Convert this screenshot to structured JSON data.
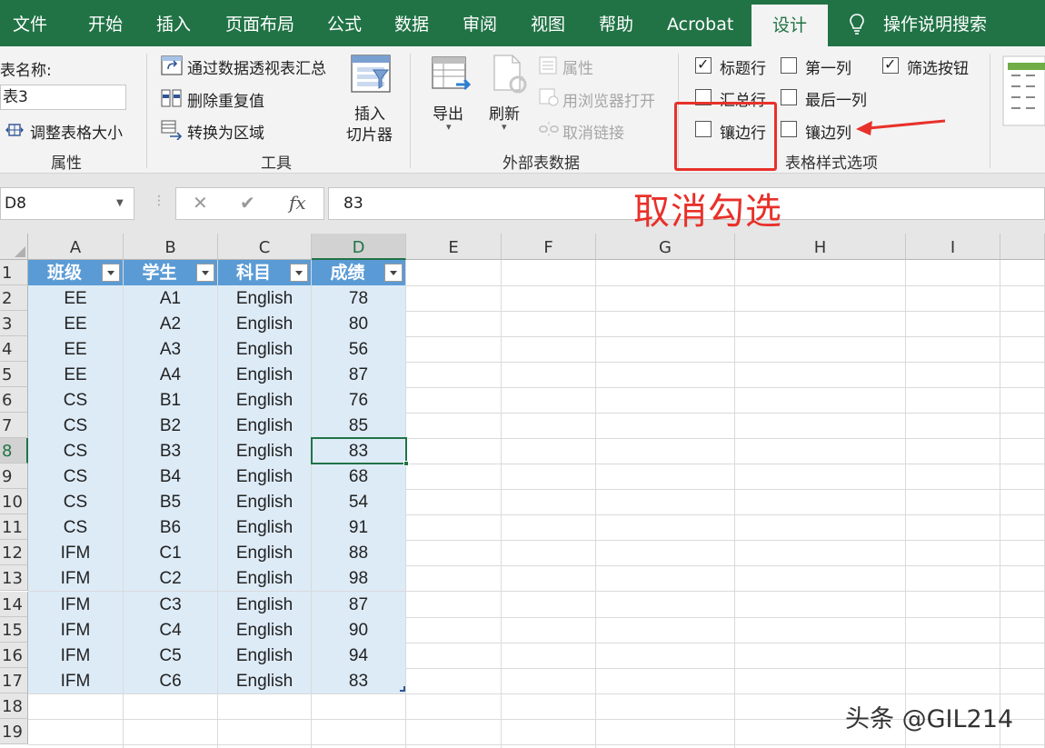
{
  "menu": {
    "tabs": [
      "文件",
      "开始",
      "插入",
      "页面布局",
      "公式",
      "数据",
      "审阅",
      "视图",
      "帮助",
      "Acrobat",
      "设计"
    ],
    "active_tab": "设计",
    "search": "操作说明搜索"
  },
  "ribbon": {
    "properties": {
      "table_name_label": "表名称:",
      "table_name_value": "表3",
      "resize_label": "调整表格大小",
      "group_label": "属性"
    },
    "tools": {
      "pivot_label": "通过数据透视表汇总",
      "dedupe_label": "删除重复值",
      "convert_label": "转换为区域",
      "slicer_label_line1": "插入",
      "slicer_label_line2": "切片器",
      "group_label": "工具"
    },
    "external": {
      "export_label": "导出",
      "refresh_label": "刷新",
      "properties_label": "属性",
      "open_browser_label": "用浏览器打开",
      "unlink_label": "取消链接",
      "group_label": "外部表数据"
    },
    "style_options": {
      "header_row": {
        "label": "标题行",
        "checked": true
      },
      "total_row": {
        "label": "汇总行",
        "checked": false
      },
      "banded_rows": {
        "label": "镶边行",
        "checked": false
      },
      "first_column": {
        "label": "第一列",
        "checked": false
      },
      "last_column": {
        "label": "最后一列",
        "checked": false
      },
      "banded_columns": {
        "label": "镶边列",
        "checked": false
      },
      "filter_button": {
        "label": "筛选按钮",
        "checked": true
      },
      "group_label": "表格样式选项"
    }
  },
  "formula_bar": {
    "name_box": "D8",
    "fx": "fx",
    "value": "83"
  },
  "annotation": "取消勾选",
  "sheet": {
    "columns": [
      "A",
      "B",
      "C",
      "D",
      "E",
      "F",
      "G",
      "H",
      "I"
    ],
    "row_numbers": [
      "1",
      "2",
      "3",
      "4",
      "5",
      "6",
      "7",
      "8",
      "9",
      "10",
      "11",
      "12",
      "13",
      "14",
      "15",
      "16",
      "17",
      "18",
      "19"
    ],
    "header": [
      "班级",
      "学生",
      "科目",
      "成绩"
    ],
    "rows": [
      [
        "EE",
        "A1",
        "English",
        "78"
      ],
      [
        "EE",
        "A2",
        "English",
        "80"
      ],
      [
        "EE",
        "A3",
        "English",
        "56"
      ],
      [
        "EE",
        "A4",
        "English",
        "87"
      ],
      [
        "CS",
        "B1",
        "English",
        "76"
      ],
      [
        "CS",
        "B2",
        "English",
        "85"
      ],
      [
        "CS",
        "B3",
        "English",
        "83"
      ],
      [
        "CS",
        "B4",
        "English",
        "68"
      ],
      [
        "CS",
        "B5",
        "English",
        "54"
      ],
      [
        "CS",
        "B6",
        "English",
        "91"
      ],
      [
        "IFM",
        "C1",
        "English",
        "88"
      ],
      [
        "IFM",
        "C2",
        "English",
        "98"
      ],
      [
        "IFM",
        "C3",
        "English",
        "87"
      ],
      [
        "IFM",
        "C4",
        "English",
        "90"
      ],
      [
        "IFM",
        "C5",
        "English",
        "94"
      ],
      [
        "IFM",
        "C6",
        "English",
        "83"
      ]
    ],
    "selected_cell": "D8"
  },
  "watermark": "头条 @GIL214",
  "colors": {
    "excel_green": "#217346",
    "table_header": "#5b9bd5",
    "table_band": "#ddebf7",
    "annotation_red": "#e8312a"
  }
}
